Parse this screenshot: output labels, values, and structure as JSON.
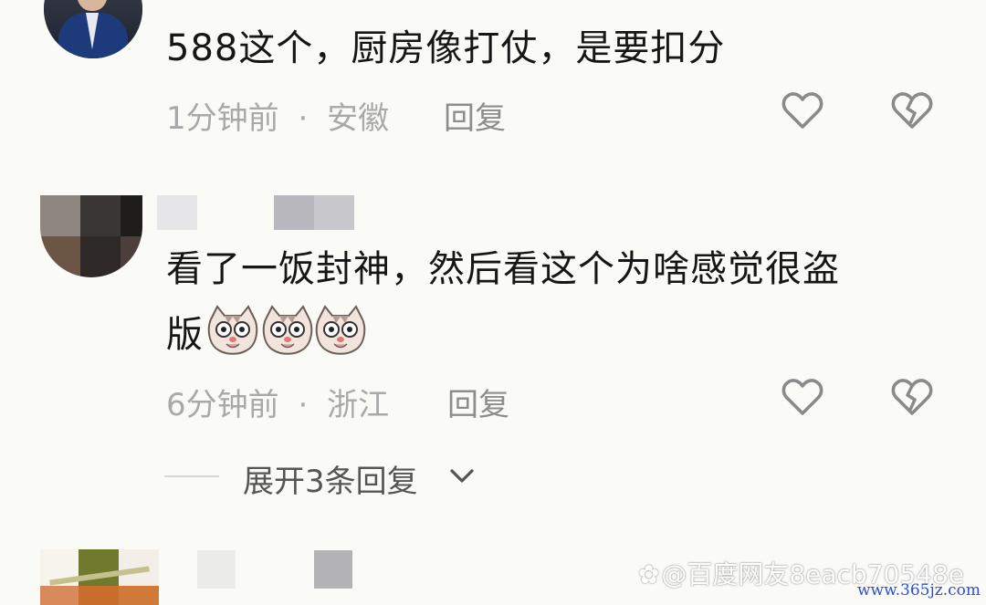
{
  "comments": [
    {
      "text": "588这个，厨房像打仗，是要扣分",
      "time": "1分钟前",
      "location": "安徽",
      "reply_label": "回复"
    },
    {
      "text_line1": "看了一饭封神，然后看这个为啥感觉很盗",
      "text_line2": "版",
      "time": "6分钟前",
      "location": "浙江",
      "reply_label": "回复",
      "emoji": "cat-face-emoji",
      "emoji_count": 3,
      "expand_label": "展开3条回复"
    }
  ],
  "meta_separator": "·",
  "icons": {
    "like": "heart-outline-icon",
    "dislike": "broken-heart-icon",
    "expand": "chevron-down-icon"
  },
  "watermark": "@百度网友8eacb70548e",
  "site_mark": "www.365jz.com",
  "colors": {
    "background": "#fafaf6",
    "text": "#161616",
    "meta": "#a9a9a9",
    "icon": "#8a8a8a",
    "site": "#2a4fd6"
  }
}
